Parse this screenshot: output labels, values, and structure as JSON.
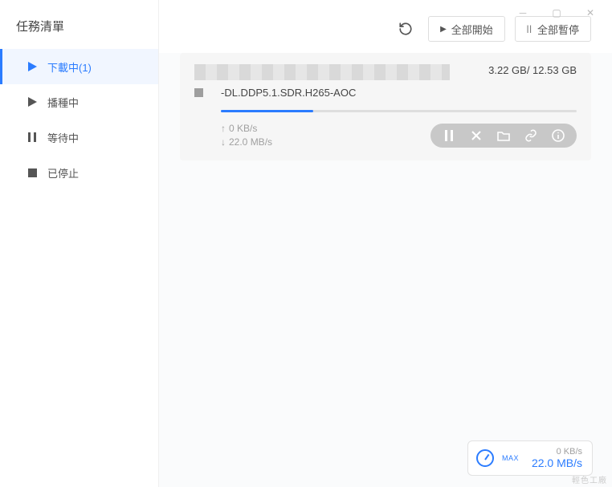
{
  "sidebar": {
    "title": "任務清單",
    "items": [
      {
        "label": "下載中(1)",
        "icon": "play"
      },
      {
        "label": "播種中",
        "icon": "play-solid"
      },
      {
        "label": "等待中",
        "icon": "pause"
      },
      {
        "label": "已停止",
        "icon": "stop"
      }
    ],
    "active_index": 0
  },
  "toolbar": {
    "start_all": "全部開始",
    "pause_all": "全部暫停"
  },
  "task": {
    "filename_line2": "-DL.DDP5.1.SDR.H265-AOC",
    "size_done": "3.22 GB",
    "size_total": "12.53 GB",
    "size_display": "3.22 GB/ 12.53 GB",
    "upload_speed": "0 KB/s",
    "download_speed": "22.0 MB/s",
    "progress_percent": 26,
    "actions": [
      "pause",
      "cancel",
      "folder",
      "link",
      "info"
    ]
  },
  "speed_widget": {
    "label": "MAX",
    "up": "0 KB/s",
    "down": "22.0 MB/s"
  },
  "watermark": "輕色工廠"
}
